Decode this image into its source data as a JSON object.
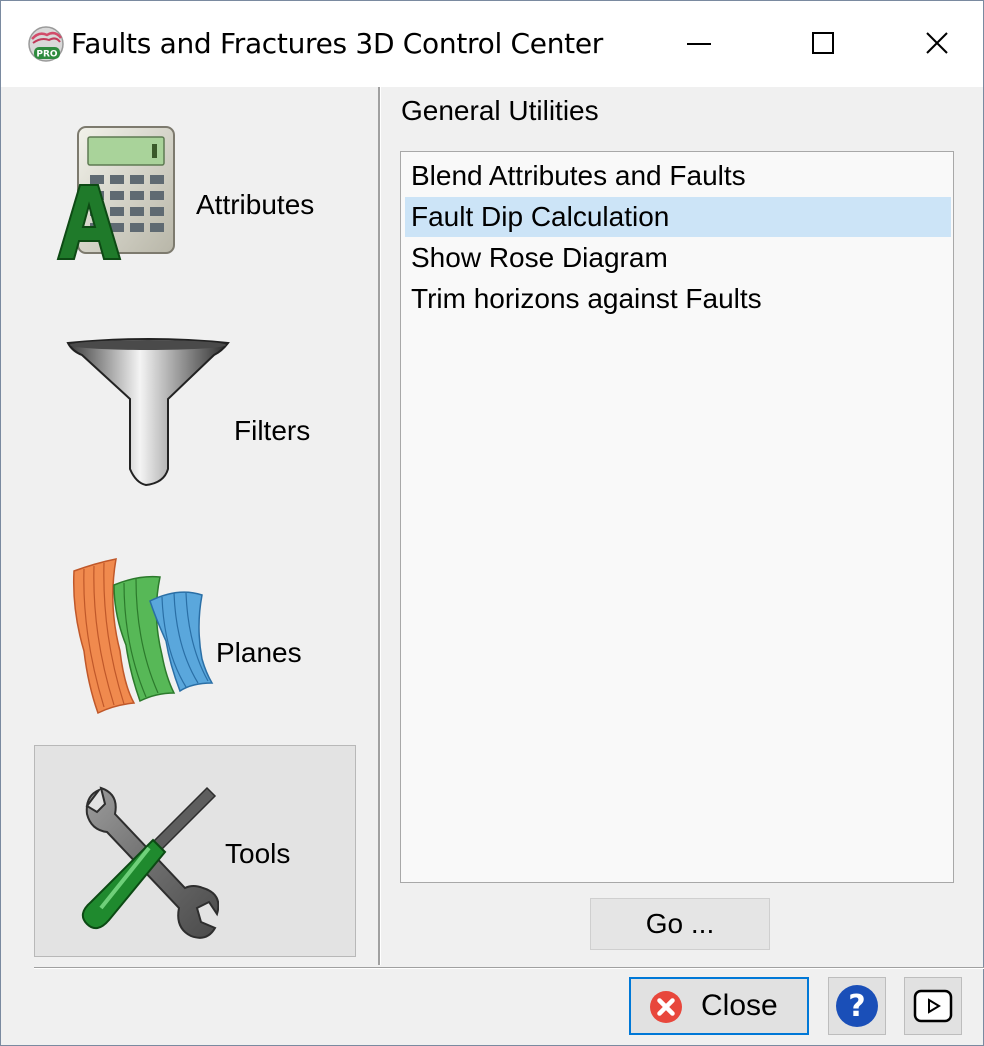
{
  "window": {
    "title": "Faults and Fractures 3D Control Center",
    "app_icon": "pro-app-icon",
    "controls": [
      "minimize-icon",
      "maximize-icon",
      "close-icon"
    ]
  },
  "sidebar": {
    "items": [
      {
        "label": "Attributes",
        "icon": "calculator-icon",
        "selected": false
      },
      {
        "label": "Filters",
        "icon": "funnel-icon",
        "selected": false
      },
      {
        "label": "Planes",
        "icon": "planes-icon",
        "selected": false
      },
      {
        "label": "Tools",
        "icon": "tools-icon",
        "selected": true
      }
    ]
  },
  "main": {
    "section_title": "General Utilities",
    "list": [
      {
        "label": "Blend Attributes and Faults",
        "selected": false
      },
      {
        "label": "Fault Dip Calculation",
        "selected": true
      },
      {
        "label": "Show Rose Diagram",
        "selected": false
      },
      {
        "label": "Trim horizons against Faults",
        "selected": false
      }
    ],
    "go_label": "Go ..."
  },
  "footer": {
    "close_label": "Close",
    "help_icon": "help-icon",
    "play_icon": "play-icon"
  },
  "colors": {
    "selection": "#cce4f7",
    "focus_border": "#0078d7",
    "help_blue": "#1a4fb8",
    "close_red": "#e8473c"
  }
}
